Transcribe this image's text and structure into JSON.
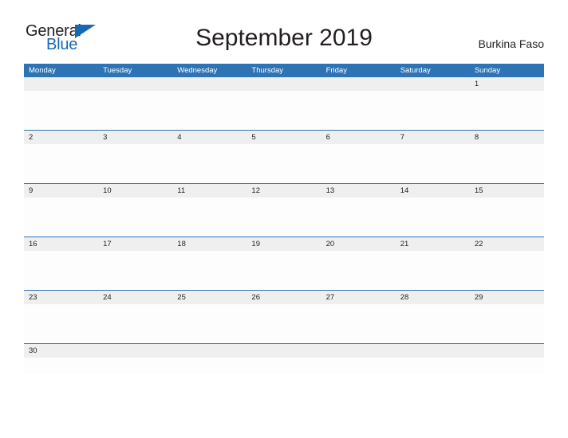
{
  "brand": {
    "name_part1": "General",
    "name_part2": "Blue",
    "flag_icon": "blue-triangle-flag-icon",
    "color_dark": "#231f20",
    "color_blue": "#1668b3"
  },
  "header": {
    "title": "September 2019",
    "region": "Burkina Faso"
  },
  "theme": {
    "header_bar": "#2e74b5",
    "date_strip": "#efefef",
    "separator": "#2e74b5",
    "body": "#fdfdfd",
    "text": "#231f20",
    "header_text": "#ffffff"
  },
  "calendar": {
    "month": "September",
    "year": "2019",
    "week_start": "Monday",
    "weekdays": [
      "Monday",
      "Tuesday",
      "Wednesday",
      "Thursday",
      "Friday",
      "Saturday",
      "Sunday"
    ],
    "weeks": [
      {
        "days": [
          "",
          "",
          "",
          "",
          "",
          "",
          "1"
        ]
      },
      {
        "days": [
          "2",
          "3",
          "4",
          "5",
          "6",
          "7",
          "8"
        ]
      },
      {
        "days": [
          "9",
          "10",
          "11",
          "12",
          "13",
          "14",
          "15"
        ]
      },
      {
        "days": [
          "16",
          "17",
          "18",
          "19",
          "20",
          "21",
          "22"
        ]
      },
      {
        "days": [
          "23",
          "24",
          "25",
          "26",
          "27",
          "28",
          "29"
        ]
      },
      {
        "days": [
          "30",
          "",
          "",
          "",
          "",
          "",
          ""
        ]
      }
    ]
  }
}
